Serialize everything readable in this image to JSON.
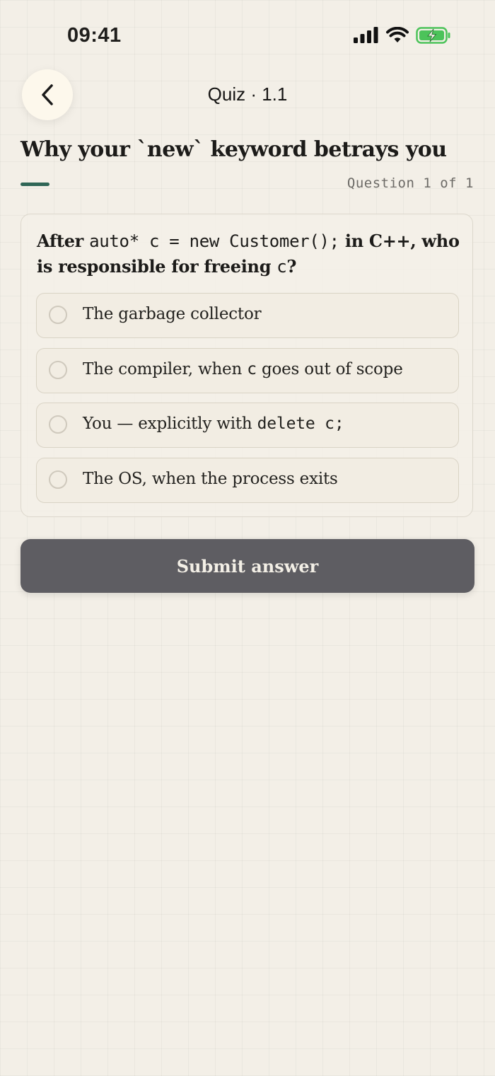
{
  "status_bar": {
    "time": "09:41",
    "icons": [
      "signal-icon",
      "wifi-icon",
      "battery-charging-icon"
    ],
    "battery_color": "#4cc35a"
  },
  "nav": {
    "back_icon": "chevron-left-icon",
    "title": "Quiz · 1.1"
  },
  "lesson": {
    "title": "Why your `new` keyword betrays you",
    "accent_color": "#2f6656",
    "progress": "Question 1 of 1"
  },
  "question": {
    "prefix": "After ",
    "code_1": "auto* c = new Customer();",
    "middle": " in C++, who is responsible for freeing ",
    "code_2": "c",
    "suffix": "?"
  },
  "options": [
    {
      "text": "The garbage collector",
      "selected": false
    },
    {
      "pre": "The compiler, when ",
      "code": "c",
      "post": " goes out of scope",
      "selected": false
    },
    {
      "pre": "You — explicitly with ",
      "code": "delete c;",
      "post": "",
      "selected": false
    },
    {
      "text": "The OS, when the process exits",
      "selected": false
    }
  ],
  "submit": {
    "label": "Submit answer",
    "color": "#5e5d62"
  }
}
